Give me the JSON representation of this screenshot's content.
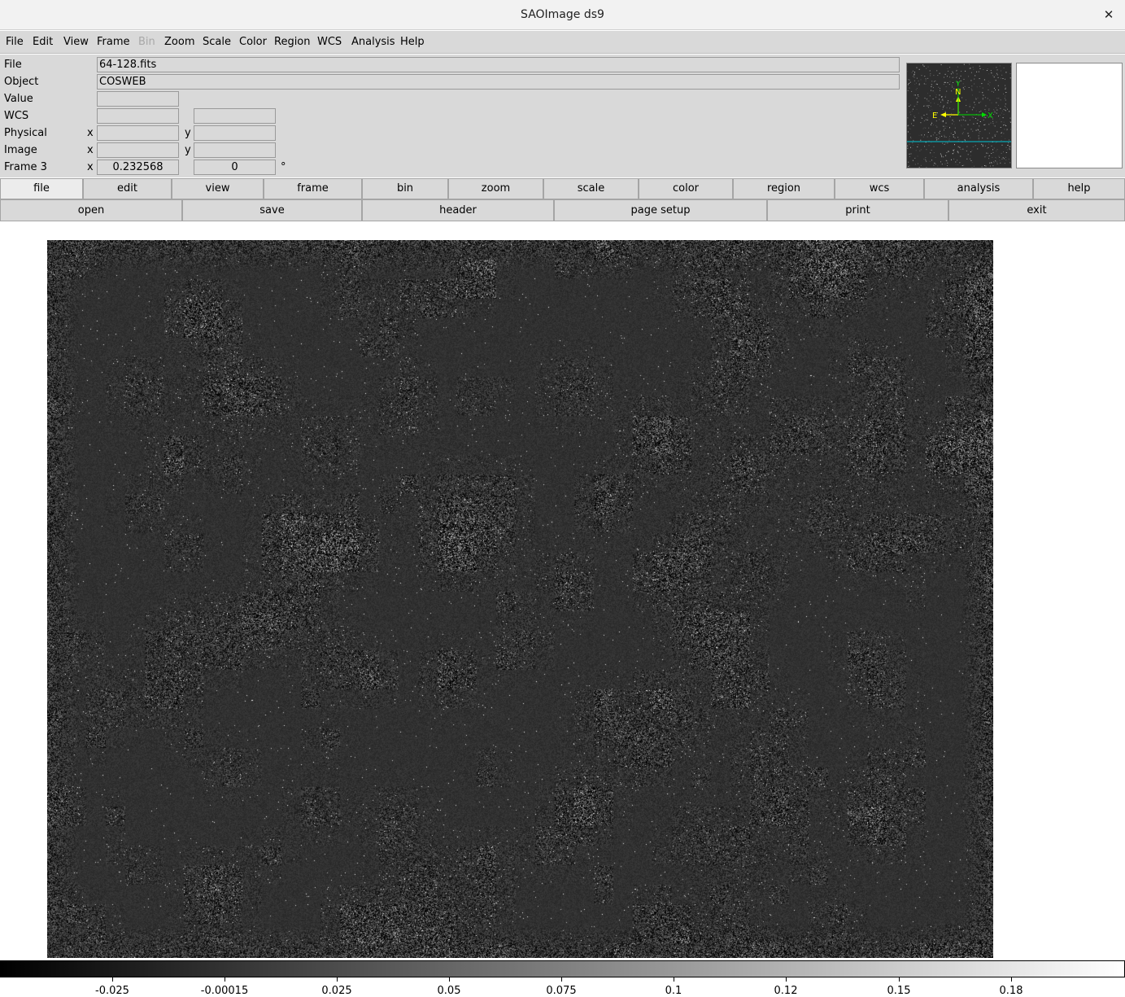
{
  "window": {
    "title": "SAOImage ds9",
    "close_glyph": "✕"
  },
  "menubar": [
    "File",
    "Edit",
    "View",
    "Frame",
    "Bin",
    "Zoom",
    "Scale",
    "Color",
    "Region",
    "WCS",
    "Analysis",
    "Help"
  ],
  "menubar_disabled": [
    "Bin"
  ],
  "info": {
    "file_label": "File",
    "file_value": "64-128.fits",
    "object_label": "Object",
    "object_value": "COSWEB",
    "value_label": "Value",
    "value_value": "",
    "wcs_label": "WCS",
    "wcs_value1": "",
    "wcs_value2": "",
    "physical_label": "Physical",
    "physical_x_label": "x",
    "physical_x": "",
    "physical_y_label": "y",
    "physical_y": "",
    "image_label": "Image",
    "image_x_label": "x",
    "image_x": "",
    "image_y_label": "y",
    "image_y": "",
    "frame_label": "Frame 3",
    "frame_x_label": "x",
    "frame_zoom": "0.232568",
    "frame_angle": "0",
    "frame_angle_unit": "°"
  },
  "panner": {
    "north_label": "N",
    "east_label": "E",
    "x_label": "X",
    "y_label": "Y"
  },
  "buttonbar": {
    "categories": [
      "file",
      "edit",
      "view",
      "frame",
      "bin",
      "zoom",
      "scale",
      "color",
      "region",
      "wcs",
      "analysis",
      "help"
    ],
    "active_category": "file",
    "actions": [
      "open",
      "save",
      "header",
      "page setup",
      "print",
      "exit"
    ]
  },
  "colorbar": {
    "ticks": [
      "-0.025",
      "-0.00015",
      "0.025",
      "0.05",
      "0.075",
      "0.1",
      "0.12",
      "0.15",
      "0.18"
    ]
  },
  "colors": {
    "panel": "#d9d9d9",
    "image_bg": "#303030",
    "panner_n": "#ffff00",
    "panner_x": "#00dd00",
    "panner_line": "#00c8d8"
  }
}
